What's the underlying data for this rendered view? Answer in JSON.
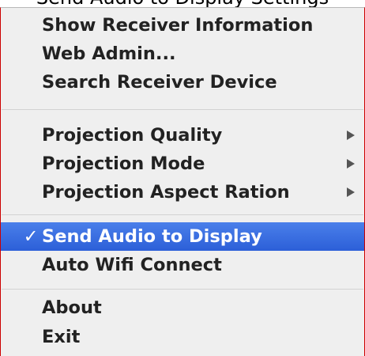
{
  "top_sliver_text": "Send Audio to Display Settings",
  "menu": {
    "items": [
      {
        "label": "Show Receiver Information",
        "checked": false,
        "submenu": false,
        "highlighted": false
      },
      {
        "label": "Web Admin...",
        "checked": false,
        "submenu": false,
        "highlighted": false
      },
      {
        "label": "Search Receiver Device",
        "checked": false,
        "submenu": false,
        "highlighted": false
      },
      {
        "label": "Projection Quality",
        "checked": false,
        "submenu": true,
        "highlighted": false
      },
      {
        "label": "Projection Mode",
        "checked": false,
        "submenu": true,
        "highlighted": false
      },
      {
        "label": "Projection Aspect Ration",
        "checked": false,
        "submenu": true,
        "highlighted": false
      },
      {
        "label": "Send Audio to Display",
        "checked": true,
        "check_mark": "✓",
        "submenu": false,
        "highlighted": true
      },
      {
        "label": "Auto Wifi Connect",
        "checked": false,
        "submenu": false,
        "highlighted": false
      },
      {
        "label": "About",
        "checked": false,
        "submenu": false,
        "highlighted": false
      },
      {
        "label": "Exit",
        "checked": false,
        "submenu": false,
        "highlighted": false
      }
    ]
  },
  "colors": {
    "highlight": "#3a6fe3",
    "menu_background": "#efefef",
    "border_accent": "#cc0000"
  }
}
